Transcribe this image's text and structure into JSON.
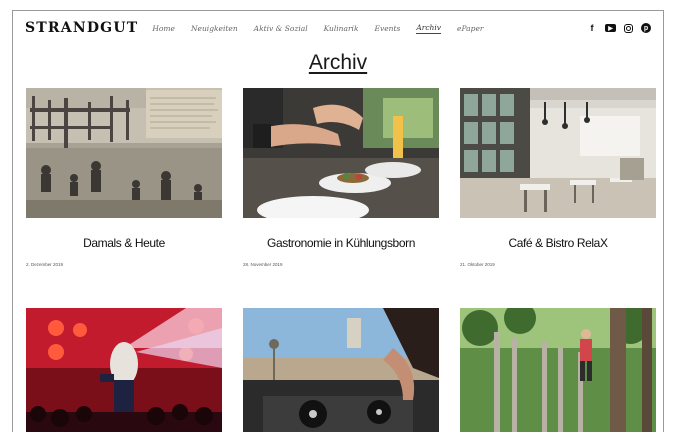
{
  "site": {
    "logo": "STRANDGUT",
    "nav": [
      {
        "label": "Home",
        "active": false
      },
      {
        "label": "Neuigkeiten",
        "active": false
      },
      {
        "label": "Aktiv & Sozial",
        "active": false
      },
      {
        "label": "Kulinarik",
        "active": false
      },
      {
        "label": "Events",
        "active": false
      },
      {
        "label": "Archiv",
        "active": true
      },
      {
        "label": "ePaper",
        "active": false
      }
    ],
    "social": [
      {
        "icon": "facebook-icon",
        "glyph": "f"
      },
      {
        "icon": "youtube-icon",
        "glyph": "▶"
      },
      {
        "icon": "instagram-icon",
        "glyph": ""
      },
      {
        "icon": "pinterest-icon",
        "glyph": "p"
      }
    ]
  },
  "page": {
    "title": "Archiv"
  },
  "posts": [
    {
      "title": "Damals & Heute",
      "date": "2. Dezember 2019",
      "image": "vintage-beach-photo"
    },
    {
      "title": "Gastronomie in Kühlungsborn",
      "date": "28. November 2019",
      "image": "chef-plating-food"
    },
    {
      "title": "Café & Bistro RelaX",
      "date": "21. Oktober 2019",
      "image": "cafe-interior"
    },
    {
      "title": "",
      "date": "",
      "image": "concert-stage"
    },
    {
      "title": "",
      "date": "",
      "image": "dj-turntables"
    },
    {
      "title": "",
      "date": "",
      "image": "climbing-forest"
    }
  ],
  "colors": {
    "text": "#111111",
    "muted": "#666666",
    "border": "#9a9a9a"
  }
}
